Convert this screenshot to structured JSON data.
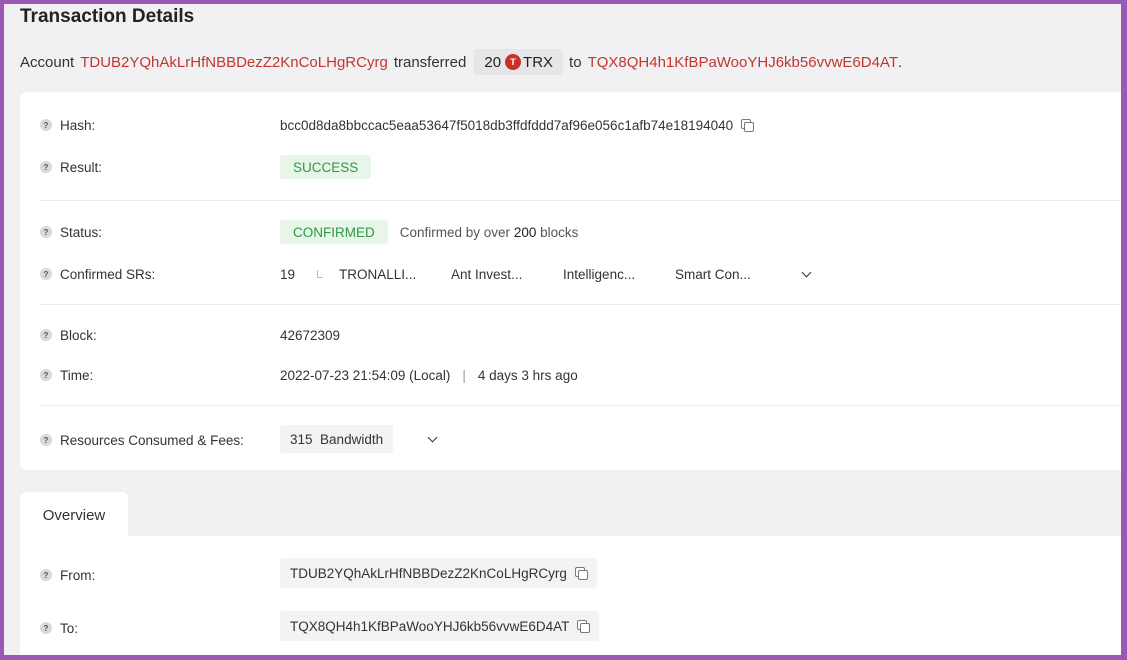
{
  "page": {
    "title": "Transaction Details"
  },
  "summary": {
    "account_label": "Account",
    "from_address": "TDUB2YQhAkLrHfNBBDezZ2KnCoLHgRCyrg",
    "transferred_label": "transferred",
    "amount": "20",
    "token": "TRX",
    "to_label": "to",
    "to_address": "TQX8QH4h1KfBPaWooYHJ6kb56vvwE6D4AT",
    "period": "."
  },
  "details": {
    "hash_label": "Hash:",
    "hash_value": "bcc0d8da8bbccac5eaa53647f5018db3ffdfddd7af96e056c1afb74e18194040",
    "result_label": "Result:",
    "result_value": "SUCCESS",
    "status_label": "Status:",
    "status_value": "CONFIRMED",
    "status_note_prefix": "Confirmed by over",
    "status_note_count": "200",
    "status_note_suffix": "blocks",
    "srs_label": "Confirmed SRs:",
    "srs_count": "19",
    "srs": [
      "TRONALLI...",
      "Ant Invest...",
      "Intelligenc...",
      "Smart Con..."
    ],
    "block_label": "Block:",
    "block_value": "42672309",
    "time_label": "Time:",
    "time_value": "2022-07-23 21:54:09 (Local)",
    "time_sep": "|",
    "time_ago": "4 days 3 hrs ago",
    "resources_label": "Resources Consumed & Fees:",
    "bandwidth_value": "315",
    "bandwidth_label": "Bandwidth"
  },
  "overview": {
    "tab_label": "Overview",
    "from_label": "From:",
    "from_value": "TDUB2YQhAkLrHfNBBDezZ2KnCoLHgRCyrg",
    "to_label": "To:",
    "to_value": "TQX8QH4h1KfBPaWooYHJ6kb56vvwE6D4AT"
  },
  "icons": {
    "help": "?",
    "token_glyph": "T"
  },
  "colors": {
    "accent_red": "#c23631",
    "success_green": "#2e9a44",
    "frame": "#9b59b6"
  }
}
